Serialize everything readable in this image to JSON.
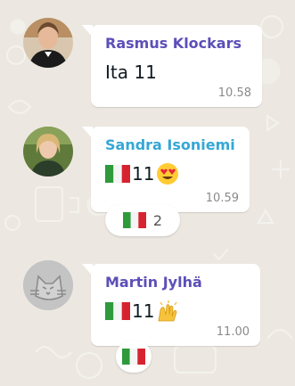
{
  "messages": [
    {
      "sender": "Rasmus Klockars",
      "sender_color": "#5b4fb8",
      "text": "Ita 11",
      "time": "10.58"
    },
    {
      "sender": "Sandra Isoniemi",
      "sender_color": "#35a7d6",
      "text": "11",
      "time": "10.59",
      "emoji": "smiling-face-with-heart-eyes",
      "reaction": {
        "emoji": "italy-flag",
        "count": "2"
      }
    },
    {
      "sender": "Martin Jylhä",
      "sender_color": "#5b4fb8",
      "text": "11",
      "time": "11.00",
      "emoji": "raising-hands",
      "reaction": {
        "emoji": "italy-flag"
      }
    }
  ]
}
